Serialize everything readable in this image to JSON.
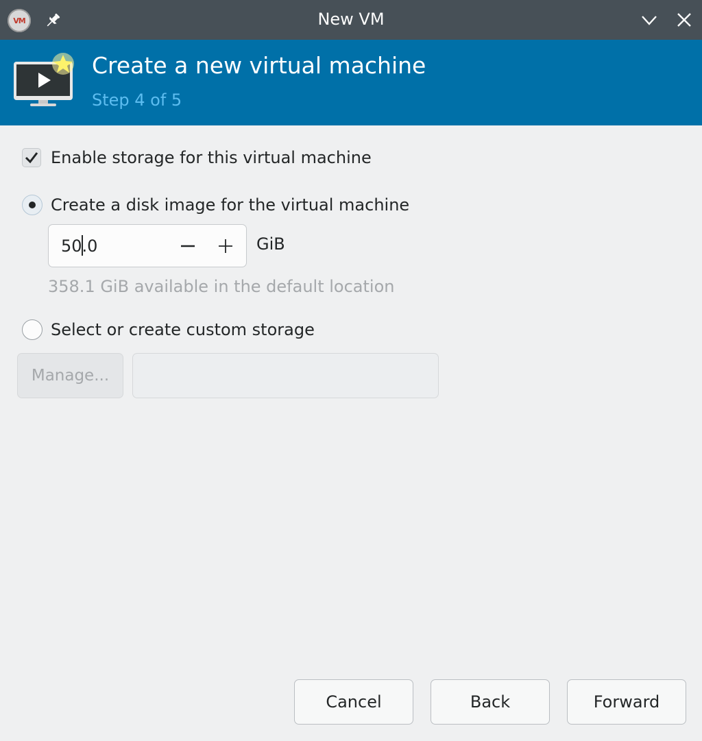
{
  "window": {
    "title": "New VM",
    "logo_text": "VM"
  },
  "header": {
    "title": "Create a new virtual machine",
    "step": "Step 4 of 5"
  },
  "storage": {
    "enable_label": "Enable storage for this virtual machine",
    "enable_checked": true,
    "create_disk_label": "Create a disk image for the virtual machine",
    "create_disk_selected": true,
    "size_value_before_caret": "50",
    "size_value_after_caret": ".0",
    "size_unit": "GiB",
    "available_text": "358.1 GiB available in the default location",
    "custom_label": "Select or create custom storage",
    "custom_selected": false,
    "manage_label": "Manage...",
    "custom_path_value": ""
  },
  "buttons": {
    "cancel": "Cancel",
    "back": "Back",
    "forward": "Forward"
  },
  "colors": {
    "titlebar": "#475057",
    "header_bg": "#0070a8",
    "step_text": "#5dbdf0",
    "window_bg": "#eff0f1"
  }
}
